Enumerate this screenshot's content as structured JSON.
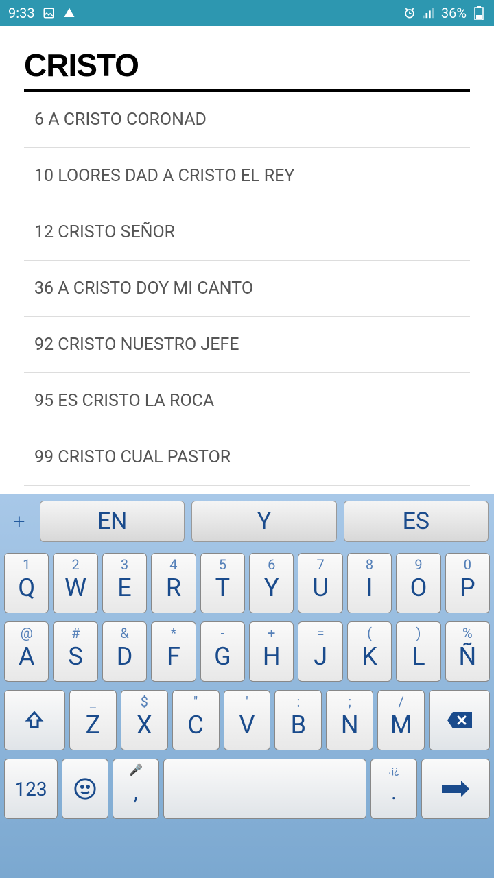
{
  "status_bar": {
    "time": "9:33",
    "battery": "36%"
  },
  "page_title": "CRISTO",
  "list": {
    "items": [
      "6 A CRISTO CORONAD",
      "10 LOORES DAD A CRISTO EL REY",
      "12 CRISTO SEÑOR",
      "36 A CRISTO DOY MI CANTO",
      "92 CRISTO NUESTRO JEFE",
      "95 ES CRISTO LA ROCA",
      "99 CRISTO CUAL PASTOR"
    ]
  },
  "keyboard": {
    "plus": "+",
    "suggestions": [
      "EN",
      "Y",
      "ES"
    ],
    "row1": [
      {
        "upper": "1",
        "main": "Q"
      },
      {
        "upper": "2",
        "main": "W"
      },
      {
        "upper": "3",
        "main": "E"
      },
      {
        "upper": "4",
        "main": "R"
      },
      {
        "upper": "5",
        "main": "T"
      },
      {
        "upper": "6",
        "main": "Y"
      },
      {
        "upper": "7",
        "main": "U"
      },
      {
        "upper": "8",
        "main": "I"
      },
      {
        "upper": "9",
        "main": "O"
      },
      {
        "upper": "0",
        "main": "P"
      }
    ],
    "row2": [
      {
        "upper": "@",
        "main": "A"
      },
      {
        "upper": "#",
        "main": "S"
      },
      {
        "upper": "&",
        "main": "D"
      },
      {
        "upper": "*",
        "main": "F"
      },
      {
        "upper": "-",
        "main": "G"
      },
      {
        "upper": "+",
        "main": "H"
      },
      {
        "upper": "=",
        "main": "J"
      },
      {
        "upper": "(",
        "main": "K"
      },
      {
        "upper": ")",
        "main": "L"
      },
      {
        "upper": "%",
        "main": "Ñ"
      }
    ],
    "row3": [
      {
        "upper": "_",
        "main": "Z"
      },
      {
        "upper": "$",
        "main": "X"
      },
      {
        "upper": "\"",
        "main": "C"
      },
      {
        "upper": "'",
        "main": "V"
      },
      {
        "upper": ":",
        "main": "B"
      },
      {
        "upper": ";",
        "main": "N"
      },
      {
        "upper": "/",
        "main": "M"
      }
    ],
    "sym_key": "123",
    "comma": ",",
    "dot": ".",
    "dot_upper": ".¡¿"
  }
}
